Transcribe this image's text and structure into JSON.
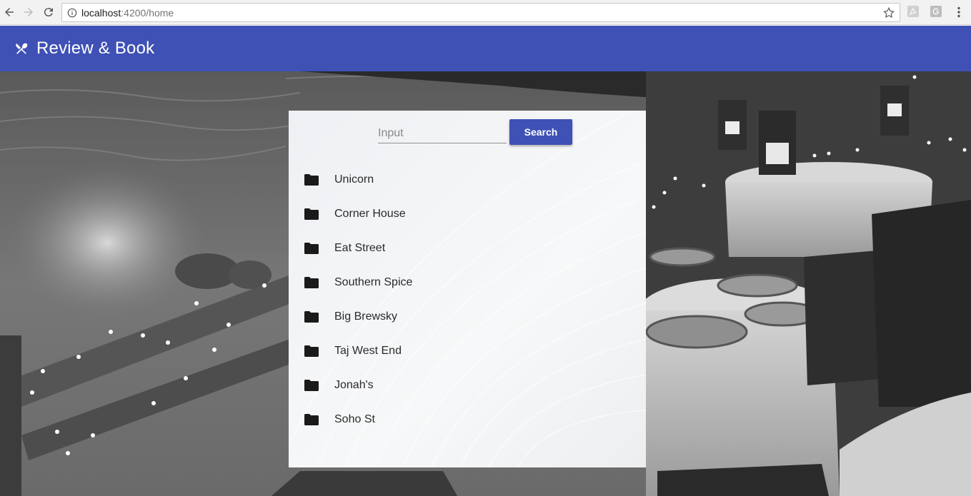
{
  "browser": {
    "url_host": "localhost",
    "url_path": ":4200/home"
  },
  "app": {
    "title": "Review & Book",
    "toolbar_color": "#3f51b5"
  },
  "search": {
    "placeholder": "Input",
    "value": "",
    "button_label": "Search"
  },
  "restaurants": [
    {
      "name": "Unicorn",
      "icon": "folder-icon"
    },
    {
      "name": "Corner House",
      "icon": "folder-icon"
    },
    {
      "name": "Eat Street",
      "icon": "folder-icon"
    },
    {
      "name": "Southern Spice",
      "icon": "folder-icon"
    },
    {
      "name": "Big Brewsky",
      "icon": "folder-icon"
    },
    {
      "name": "Taj West End",
      "icon": "folder-icon"
    },
    {
      "name": "Jonah's",
      "icon": "folder-icon"
    },
    {
      "name": "Soho St",
      "icon": "folder-icon"
    }
  ],
  "icons": {
    "logo": "fork-knife-icon",
    "back": "back-arrow-icon",
    "forward": "forward-arrow-icon",
    "reload": "reload-icon",
    "info": "info-icon",
    "bookmark": "star-icon",
    "menu": "kebab-menu-icon"
  }
}
